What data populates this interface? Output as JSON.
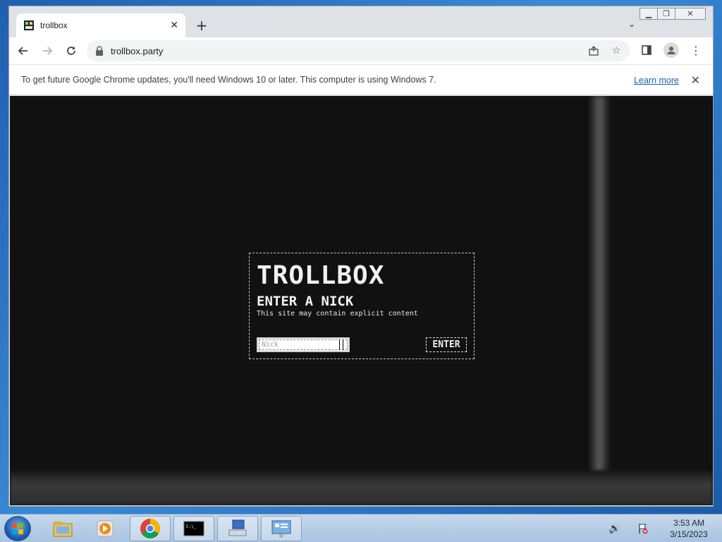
{
  "browser": {
    "tab": {
      "title": "trollbox"
    },
    "address_bar": {
      "url": "trollbox.party"
    },
    "infobar": {
      "message": "To get future Google Chrome updates, you'll need Windows 10 or later. This computer is using Windows 7.",
      "link_label": "Learn more"
    }
  },
  "page": {
    "logo": "TROLLBOX",
    "heading": "ENTER A NICK",
    "warning": "This site may contain explicit content",
    "nick_input": {
      "placeholder": "Nick",
      "value": ""
    },
    "enter_label": "ENTER"
  },
  "taskbar": {
    "pinned": [
      "windows-explorer",
      "media-player",
      "chrome",
      "command-prompt",
      "network-app",
      "remote-desktop"
    ],
    "clock": {
      "time": "3:53 AM",
      "date": "3/15/2023"
    }
  }
}
